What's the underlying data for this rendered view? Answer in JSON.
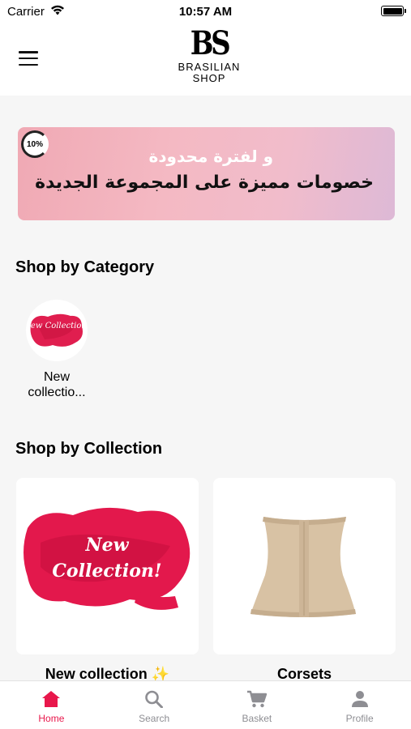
{
  "status_bar": {
    "carrier": "Carrier",
    "time": "10:57 AM"
  },
  "header": {
    "logo_mark": "BS",
    "logo_line1": "BRASILIAN",
    "logo_line2": "SHOP"
  },
  "banner": {
    "badge": "10%",
    "line1": "و لفترة محدودة",
    "line2": "خصومات مميزة على المجموعة الجديدة"
  },
  "category_section": {
    "title": "Shop by Category",
    "items": [
      {
        "label": "New collectio...",
        "image_text": "New Collection!"
      }
    ]
  },
  "collection_section": {
    "title": "Shop by Collection",
    "cards": [
      {
        "label": "New collection ✨",
        "image_text": "New Collection!"
      },
      {
        "label": "Corsets"
      }
    ]
  },
  "tab_bar": {
    "active_color": "#e8174b",
    "inactive_color": "#8e8e93",
    "tabs": [
      {
        "label": "Home",
        "icon": "home-icon"
      },
      {
        "label": "Search",
        "icon": "search-icon"
      },
      {
        "label": "Basket",
        "icon": "cart-icon"
      },
      {
        "label": "Profile",
        "icon": "person-icon"
      }
    ]
  }
}
